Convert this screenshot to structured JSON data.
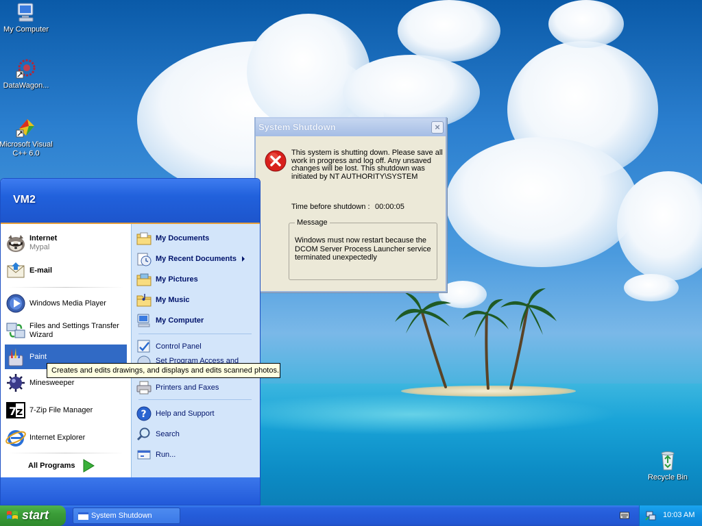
{
  "desktop": {
    "icons": [
      {
        "label": "My Computer"
      },
      {
        "label": "DataWagon..."
      },
      {
        "label": "Microsoft Visual C++ 6.0"
      },
      {
        "label": "Recycle Bin"
      }
    ]
  },
  "start_menu": {
    "user": "VM2",
    "pinned": [
      {
        "title": "Internet",
        "subtitle": "Mypal"
      },
      {
        "title": "E-mail"
      }
    ],
    "recent": [
      {
        "label": "Windows Media Player"
      },
      {
        "label": "Files and Settings Transfer Wizard"
      },
      {
        "label": "Paint"
      },
      {
        "label": "Minesweeper"
      },
      {
        "label": "7-Zip File Manager"
      },
      {
        "label": "Internet Explorer"
      }
    ],
    "all_programs": "All Programs",
    "right": {
      "my_documents": "My Documents",
      "my_recent_documents": "My Recent Documents",
      "my_pictures": "My Pictures",
      "my_music": "My Music",
      "my_computer": "My Computer",
      "control_panel": "Control Panel",
      "set_program_access": "Set Program Access and",
      "printers_and_faxes": "Printers and Faxes",
      "help_and_support": "Help and Support",
      "search": "Search",
      "run": "Run..."
    }
  },
  "tooltip": {
    "text": "Creates and edits drawings, and displays and edits scanned photos."
  },
  "dialog": {
    "title": "System Shutdown",
    "close": "×",
    "message": "This system is shutting down. Please save all work in progress and log off. Any unsaved changes will be lost. This shutdown was initiated by NT AUTHORITY\\SYSTEM",
    "timer_label": "Time before shutdown :",
    "timer_value": "00:00:05",
    "group_label": "Message",
    "group_message": "Windows must now restart because the DCOM Server Process Launcher service terminated unexpectedly"
  },
  "taskbar": {
    "start_label": "start",
    "task_button": "System Shutdown",
    "clock": "10:03 AM"
  },
  "colors": {
    "start_menu_blue": "#2161dc",
    "selection": "#316ac5",
    "start_green": "#3b9d38",
    "tray_blue": "#0f8fe0",
    "dialog_face": "#ece9d8",
    "error_red": "#d8201c"
  }
}
